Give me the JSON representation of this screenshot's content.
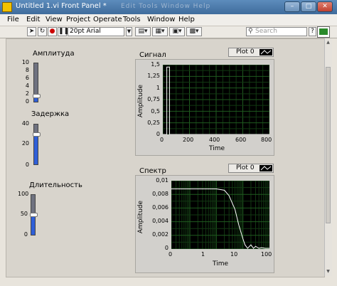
{
  "window": {
    "title": "Untitled 1.vi Front Panel *",
    "ghost_menu": "Edit   Tools   Window   Help"
  },
  "menu": [
    "File",
    "Edit",
    "View",
    "Project",
    "Operate",
    "Tools",
    "Window",
    "Help"
  ],
  "toolbar": {
    "font": "20pt Arial",
    "search_placeholder": "Search"
  },
  "sliders": [
    {
      "label": "Амплитуда",
      "ticks": [
        "10",
        "8",
        "6",
        "4",
        "2",
        "0"
      ],
      "value": 1.5,
      "max": 10
    },
    {
      "label": "Задержка",
      "ticks": [
        "40",
        "20",
        "0"
      ],
      "value": 30,
      "max": 40
    },
    {
      "label": "Длительность",
      "ticks": [
        "100",
        "50",
        "0"
      ],
      "value": 50,
      "max": 100
    }
  ],
  "graphs": {
    "signal": {
      "title": "Сигнал",
      "plot_legend": "Plot 0",
      "xlabel": "Time",
      "ylabel": "Amplitude",
      "yticks": [
        "1,5",
        "1,25",
        "1",
        "0,75",
        "0,5",
        "0,25",
        "0"
      ],
      "xticks": [
        "0",
        "200",
        "400",
        "600",
        "800"
      ]
    },
    "spectrum": {
      "title": "Спектр",
      "plot_legend": "Plot 0",
      "xlabel": "Time",
      "ylabel": "Amplitude",
      "yticks": [
        "0,01",
        "0,008",
        "0,006",
        "0,004",
        "0,002",
        "0"
      ],
      "xticks": [
        "0",
        "1",
        "10",
        "100"
      ]
    }
  },
  "chart_data": [
    {
      "type": "line",
      "title": "Сигнал",
      "xlabel": "Time",
      "ylabel": "Amplitude",
      "xlim": [
        0,
        800
      ],
      "ylim": [
        0,
        1.5
      ],
      "grid": true,
      "series": [
        {
          "name": "Plot 0",
          "x": [
            0,
            30,
            30,
            50,
            50,
            800
          ],
          "y": [
            0,
            0,
            1.45,
            1.45,
            0,
            0
          ]
        }
      ]
    },
    {
      "type": "line",
      "title": "Спектр",
      "xlabel": "Time",
      "ylabel": "Amplitude",
      "xscale": "log",
      "xlim": [
        0.02,
        100
      ],
      "ylim": [
        0,
        0.01
      ],
      "grid": true,
      "series": [
        {
          "name": "Plot 0",
          "x": [
            0.02,
            0.1,
            0.5,
            1,
            2,
            3,
            5,
            7,
            10,
            12,
            15,
            20,
            25,
            30,
            40,
            50,
            70,
            100
          ],
          "y": [
            0.0088,
            0.0088,
            0.0088,
            0.0088,
            0.0086,
            0.0078,
            0.0058,
            0.0035,
            0.0015,
            0.0006,
            0.0001,
            0.0006,
            0.0001,
            0.0004,
            0.0001,
            0.0002,
            0.0001,
            0.0001
          ]
        }
      ]
    }
  ]
}
